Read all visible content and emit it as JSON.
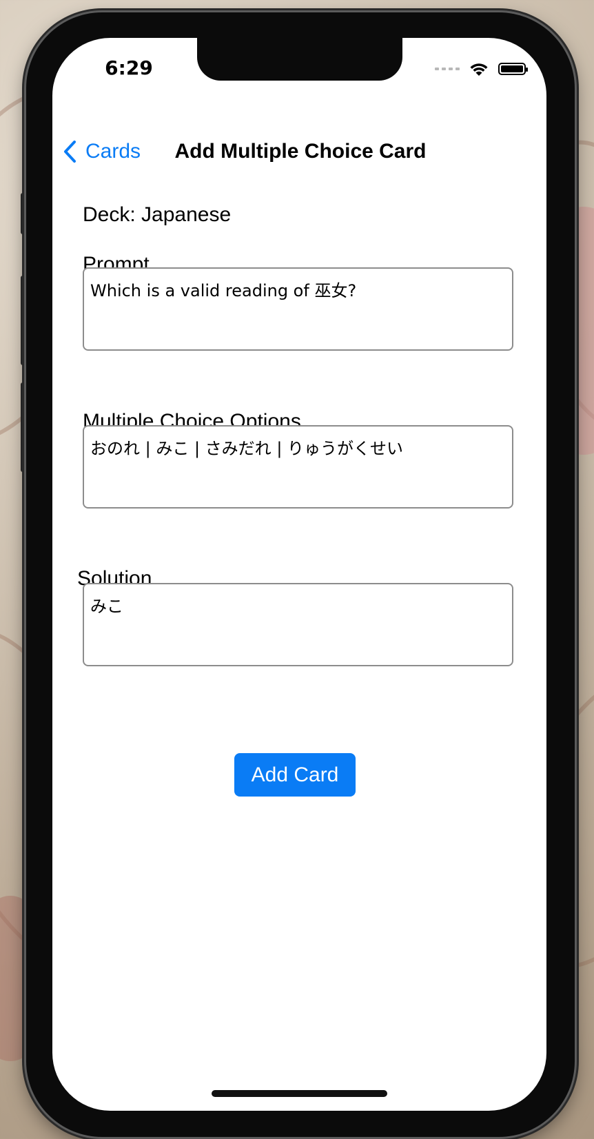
{
  "status_bar": {
    "time": "6:29",
    "icons": [
      "cellular-dots-icon",
      "wifi-icon",
      "battery-icon"
    ]
  },
  "nav": {
    "back_label": "Cards",
    "title": "Add Multiple Choice Card"
  },
  "form": {
    "deck_label": "Deck: Japanese",
    "prompt_label": "Prompt",
    "prompt_value": "Which is a valid reading of 巫女?",
    "options_label": "Multiple Choice Options",
    "options_value": "おのれ | みこ | さみだれ | りゅうがくせい",
    "solution_label": "Solution",
    "solution_value": "みこ"
  },
  "actions": {
    "add_card_label": "Add Card"
  },
  "colors": {
    "accent": "#0a7cf5",
    "screen_bg": "#ffffff",
    "field_border": "#8c8c8c"
  }
}
